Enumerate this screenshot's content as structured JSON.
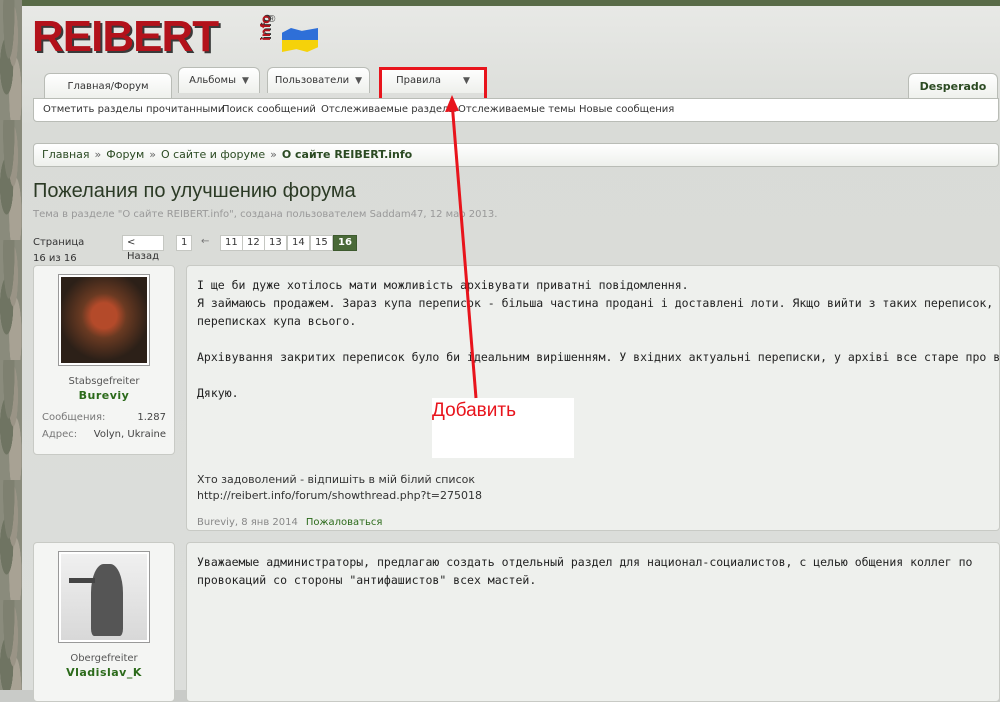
{
  "logo": {
    "text": "REIBERT",
    "suffix": "info",
    "reg": "®"
  },
  "nav": {
    "tabs": [
      {
        "label": "Главная/Форум",
        "chevron": false
      },
      {
        "label": "Альбомы",
        "chevron": true
      },
      {
        "label": "Пользователи",
        "chevron": true
      },
      {
        "label": "Правила",
        "chevron": true
      }
    ],
    "user": "Desperado",
    "subnav": [
      "Отметить разделы прочитанными",
      "Поиск сообщений",
      "Отслеживаемые разделы",
      "Отслеживаемые темы",
      "Новые сообщения"
    ]
  },
  "breadcrumb": {
    "items": [
      "Главная",
      "Форум",
      "О сайте и форуме",
      "О сайте REIBERT.info"
    ],
    "sep": "»"
  },
  "thread": {
    "title": "Пожелания по улучшению форума",
    "meta": "Тема в разделе \"О сайте REIBERT.info\", создана пользователем Saddam47, 12 мар 2013."
  },
  "pager": {
    "label": "Страница 16 из 16",
    "prev": "< Назад",
    "pages": [
      "1",
      "←",
      "11",
      "12",
      "13",
      "14",
      "15",
      "16"
    ],
    "current": "16"
  },
  "posts": [
    {
      "rank": "Stabsgefreiter",
      "username": "Bureviy",
      "stats": [
        {
          "label": "Сообщения:",
          "value": "1.287"
        },
        {
          "label": "Адрес:",
          "value": "Volyn, Ukraine"
        }
      ],
      "lines": [
        "І ще би дуже хотілось мати можливість архівувати приватні повідомлення.",
        "Я займаюсь продажем. Зараз купа переписок - більша частина продані і доставлені лоти. Якщо вийти з таких переписок, т",
        "переписках купа всього.",
        "",
        "Архівування закритих переписок було би ідеальним вирішенням. У вхідних актуальні переписки, у архіві все старе про всян",
        "",
        "Дякую."
      ],
      "signature": [
        "Хто задоволений - відпишіть в мій білий список",
        "http://reibert.info/forum/showthread.php?t=275018"
      ],
      "author": "Bureviy",
      "date": "8 янв 2014",
      "report": "Пожаловаться"
    },
    {
      "rank": "Obergefreiter",
      "username": "Vladislav_K",
      "lines": [
        "Уважаемые администраторы, предлагаю создать отдельный раздел для национал-социалистов, с целью общения коллег по",
        "провокаций со стороны \"антифашистов\" всех мастей."
      ]
    }
  ],
  "annotation": {
    "text": "Добавить",
    "color": "#e8141c"
  }
}
